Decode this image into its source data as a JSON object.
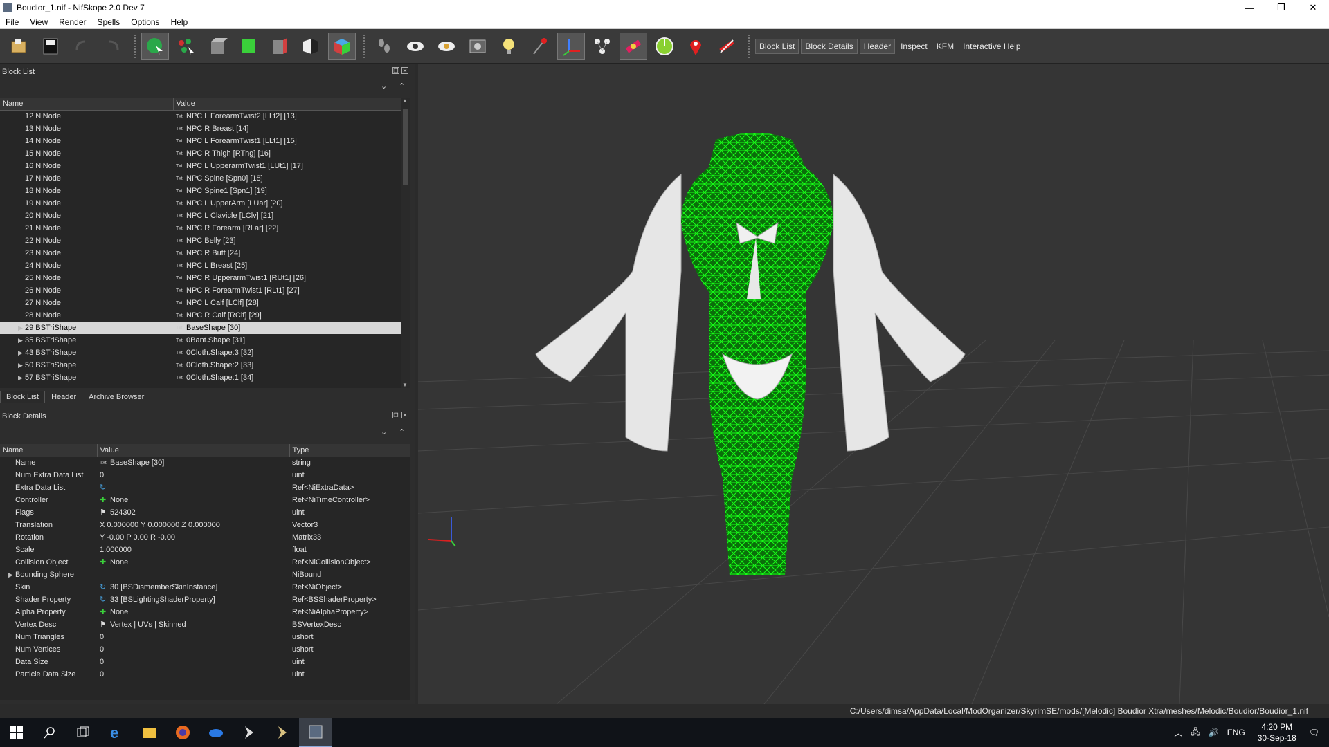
{
  "window": {
    "title": "Boudior_1.nif - NifSkope 2.0 Dev 7",
    "min_glyph": "—",
    "max_glyph": "❐",
    "close_glyph": "✕"
  },
  "menu": [
    "File",
    "View",
    "Render",
    "Spells",
    "Options",
    "Help"
  ],
  "toolbar": {
    "text_buttons": [
      "Block List",
      "Block Details",
      "Header",
      "Inspect",
      "KFM",
      "Interactive Help"
    ],
    "icon_colors": {
      "select": "#2aa84a",
      "box_blue": "#4aa8e8",
      "box_green": "#3ad03a",
      "box_red": "#d04040",
      "light": "#f5e27a",
      "pin": "#e02020",
      "ring": "#8ad030"
    }
  },
  "block_list": {
    "title": "Block List",
    "columns": [
      "Name",
      "Value"
    ],
    "rows": [
      {
        "name": "12 NiNode",
        "value": "NPC L ForearmTwist2 [LLt2] [13]"
      },
      {
        "name": "13 NiNode",
        "value": "NPC R Breast [14]"
      },
      {
        "name": "14 NiNode",
        "value": "NPC L ForearmTwist1 [LLt1] [15]"
      },
      {
        "name": "15 NiNode",
        "value": "NPC R Thigh [RThg] [16]"
      },
      {
        "name": "16 NiNode",
        "value": "NPC L UpperarmTwist1 [LUt1] [17]"
      },
      {
        "name": "17 NiNode",
        "value": "NPC Spine [Spn0] [18]"
      },
      {
        "name": "18 NiNode",
        "value": "NPC Spine1 [Spn1] [19]"
      },
      {
        "name": "19 NiNode",
        "value": "NPC L UpperArm [LUar] [20]"
      },
      {
        "name": "20 NiNode",
        "value": "NPC L Clavicle [LClv] [21]"
      },
      {
        "name": "21 NiNode",
        "value": "NPC R Forearm [RLar] [22]"
      },
      {
        "name": "22 NiNode",
        "value": "NPC Belly [23]"
      },
      {
        "name": "23 NiNode",
        "value": "NPC R Butt [24]"
      },
      {
        "name": "24 NiNode",
        "value": "NPC L Breast [25]"
      },
      {
        "name": "25 NiNode",
        "value": "NPC R UpperarmTwist1 [RUt1] [26]"
      },
      {
        "name": "26 NiNode",
        "value": "NPC R ForearmTwist1 [RLt1] [27]"
      },
      {
        "name": "27 NiNode",
        "value": "NPC L Calf [LClf] [28]"
      },
      {
        "name": "28 NiNode",
        "value": "NPC R Calf [RClf] [29]"
      },
      {
        "name": "29 BSTriShape",
        "value": "BaseShape [30]",
        "selected": true,
        "expandable": true
      },
      {
        "name": "35 BSTriShape",
        "value": "0Bant.Shape [31]",
        "expandable": true
      },
      {
        "name": "43 BSTriShape",
        "value": "0Cloth.Shape:3 [32]",
        "expandable": true
      },
      {
        "name": "50 BSTriShape",
        "value": "0Cloth.Shape:2 [33]",
        "expandable": true
      },
      {
        "name": "57 BSTriShape",
        "value": "0Cloth.Shape:1 [34]",
        "expandable": true
      }
    ]
  },
  "tabs": [
    "Block List",
    "Header",
    "Archive Browser"
  ],
  "block_details": {
    "title": "Block Details",
    "columns": [
      "Name",
      "Value",
      "Type"
    ],
    "rows": [
      {
        "name": "Name",
        "value": "BaseShape [30]",
        "type": "string",
        "icon": "txt"
      },
      {
        "name": "Num Extra Data List",
        "value": "0",
        "type": "uint"
      },
      {
        "name": "Extra Data List",
        "value": "",
        "type": "Ref<NiExtraData>",
        "icon": "link"
      },
      {
        "name": "Controller",
        "value": "None",
        "type": "Ref<NiTimeController>",
        "icon": "plus"
      },
      {
        "name": "Flags",
        "value": "524302",
        "type": "uint",
        "icon": "flag"
      },
      {
        "name": "Translation",
        "value": "X 0.000000 Y 0.000000 Z 0.000000",
        "type": "Vector3"
      },
      {
        "name": "Rotation",
        "value": "Y -0.00 P 0.00 R -0.00",
        "type": "Matrix33"
      },
      {
        "name": "Scale",
        "value": "1.000000",
        "type": "float"
      },
      {
        "name": "Collision Object",
        "value": "None",
        "type": "Ref<NiCollisionObject>",
        "icon": "plus"
      },
      {
        "name": "Bounding Sphere",
        "value": "",
        "type": "NiBound",
        "expandable": true
      },
      {
        "name": "Skin",
        "value": "30 [BSDismemberSkinInstance]",
        "type": "Ref<NiObject>",
        "icon": "link"
      },
      {
        "name": "Shader Property",
        "value": "33 [BSLightingShaderProperty]",
        "type": "Ref<BSShaderProperty>",
        "icon": "link"
      },
      {
        "name": "Alpha Property",
        "value": "None",
        "type": "Ref<NiAlphaProperty>",
        "icon": "plus"
      },
      {
        "name": "Vertex Desc",
        "value": "Vertex | UVs | Skinned",
        "type": "BSVertexDesc",
        "icon": "flag"
      },
      {
        "name": "Num Triangles",
        "value": "0",
        "type": "ushort"
      },
      {
        "name": "Num Vertices",
        "value": "0",
        "type": "ushort"
      },
      {
        "name": "Data Size",
        "value": "0",
        "type": "uint"
      },
      {
        "name": "Particle Data Size",
        "value": "0",
        "type": "uint"
      }
    ]
  },
  "status": {
    "path": "C:/Users/dimsa/AppData/Local/ModOrganizer/SkyrimSE/mods/[Melodic] Boudior Xtra/meshes/Melodic/Boudior/Boudior_1.nif"
  },
  "taskbar": {
    "lang": "ENG",
    "time": "4:20 PM",
    "date": "30-Sep-18"
  },
  "colors": {
    "wire_green": "#18ff18",
    "cloth_white": "#e6e6e6",
    "viewport_bg": "#353535",
    "selection": "#d7d7d7"
  }
}
